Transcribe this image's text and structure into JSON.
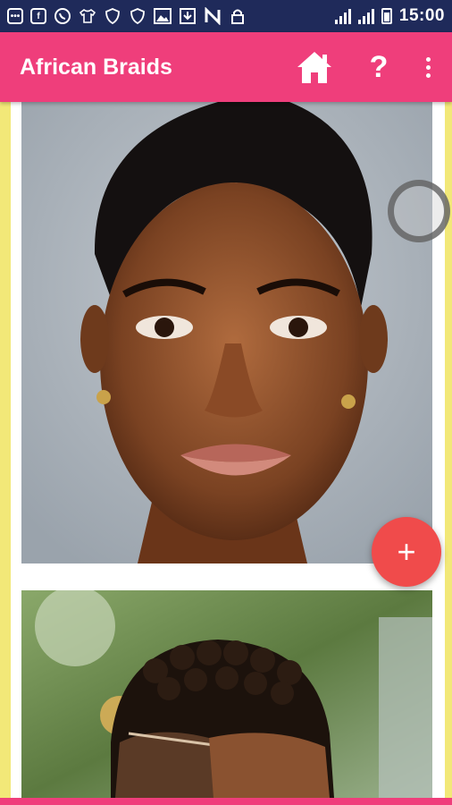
{
  "status_bar": {
    "time": "15:00",
    "icons": [
      "message-icon",
      "facebook-icon",
      "whatsapp-icon",
      "shirt-icon",
      "shield-icon",
      "shield-icon",
      "image-icon",
      "download-icon",
      "n-icon",
      "lock-icon"
    ]
  },
  "app_bar": {
    "title": "African Braids",
    "help_label": "?"
  },
  "fab": {
    "label": "+"
  },
  "images": [
    {
      "alt": "Woman with short natural hair and side shave"
    },
    {
      "alt": "Short curly hair with shaved design"
    }
  ],
  "colors": {
    "app_bar": "#ef3e7b",
    "status_bar": "#1f2a5a",
    "background": "#f2e878",
    "fab": "#f04b4b"
  }
}
